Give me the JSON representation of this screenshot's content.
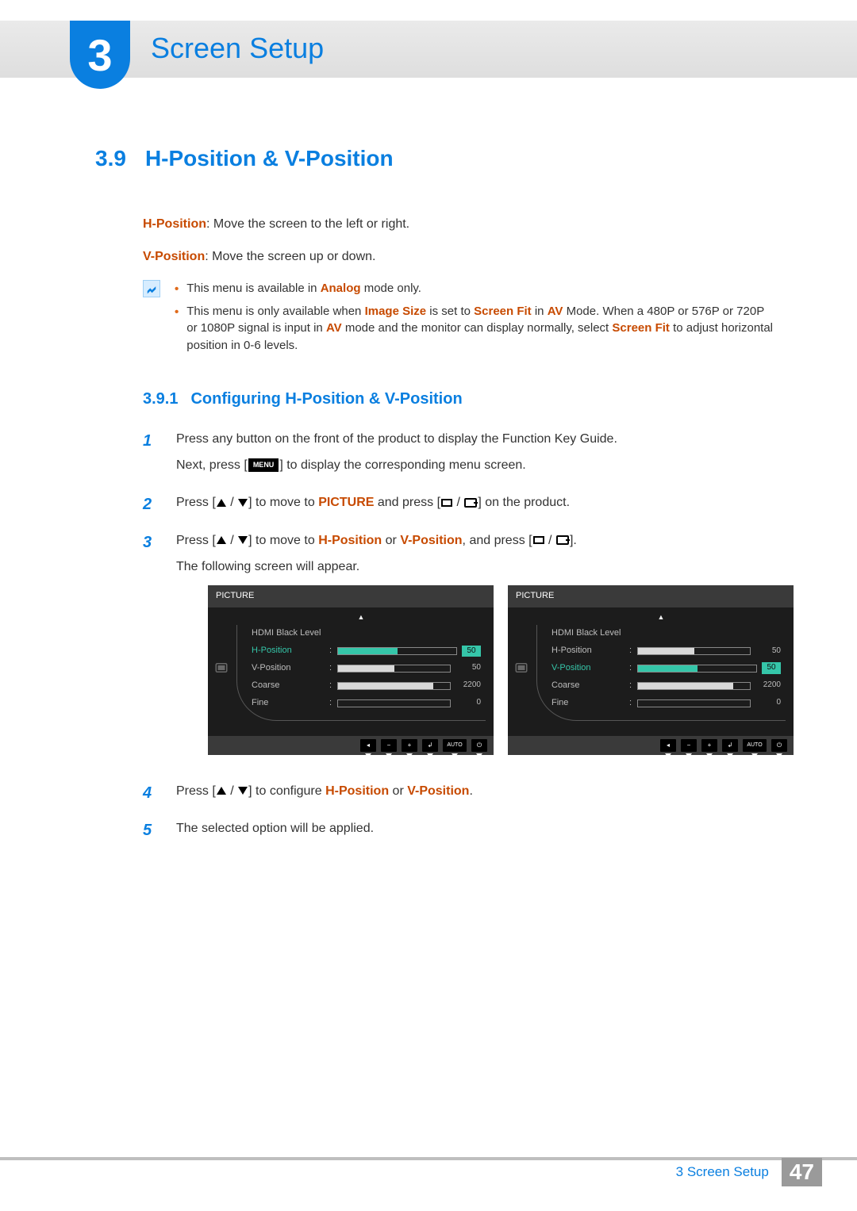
{
  "chapter": {
    "number": "3",
    "title": "Screen Setup"
  },
  "section": {
    "number": "3.9",
    "title": "H-Position & V-Position"
  },
  "defs": {
    "hpos": {
      "term": "H-Position",
      "text": ": Move the screen to the left or right."
    },
    "vpos": {
      "term": "V-Position",
      "text": ": Move the screen up or down."
    }
  },
  "notes": {
    "n1": {
      "pre": "This menu is available in ",
      "em": "Analog",
      "post": " mode only."
    },
    "n2": {
      "pre": "This menu is only available when ",
      "em1": "Image Size",
      "mid1": " is set to ",
      "em2": "Screen Fit",
      "mid2": " in ",
      "em3": "AV",
      "mid3": " Mode. When a 480P or 576P or 720P or 1080P signal is input in ",
      "em4": "AV",
      "mid4": " mode and the monitor can display normally, select ",
      "em5": "Screen Fit",
      "post": " to adjust horizontal position in 0-6 levels."
    }
  },
  "subsection": {
    "number": "3.9.1",
    "title": "Configuring H-Position & V-Position"
  },
  "steps": {
    "s1a": "Press any button on the front of the product to display the Function Key Guide.",
    "s1b_pre": "Next, press [",
    "s1b_menu": "MENU",
    "s1b_post": "] to display the corresponding menu screen.",
    "s2_pre": "Press [",
    "s2_mid1": "] to move to ",
    "s2_em": "PICTURE",
    "s2_mid2": " and press [",
    "s2_post": "] on the product.",
    "s3_pre": "Press [",
    "s3_mid1": "] to move to ",
    "s3_em1": "H-Position",
    "s3_or": " or ",
    "s3_em2": "V-Position",
    "s3_mid2": ", and press [",
    "s3_post": "].",
    "s3b": "The following screen will appear.",
    "s4_pre": "Press [",
    "s4_mid": "] to configure ",
    "s4_em1": "H-Position",
    "s4_or": " or ",
    "s4_em2": "V-Position",
    "s4_post": ".",
    "s5": "The selected option will be applied."
  },
  "osd": {
    "header": "PICTURE",
    "items": [
      {
        "label": "HDMI Black Level",
        "value": "",
        "pct": 0,
        "bar": false
      },
      {
        "label": "H-Position",
        "value": "50",
        "pct": 50,
        "bar": true
      },
      {
        "label": "V-Position",
        "value": "50",
        "pct": 50,
        "bar": true
      },
      {
        "label": "Coarse",
        "value": "2200",
        "pct": 85,
        "bar": true
      },
      {
        "label": "Fine",
        "value": "0",
        "pct": 0,
        "bar": true
      }
    ],
    "buttons": [
      "◂",
      "−",
      "+",
      "↲",
      "AUTO",
      "⏻"
    ],
    "left_selected": 1,
    "right_selected": 2
  },
  "footer": {
    "crumb": "3 Screen Setup",
    "page": "47"
  }
}
